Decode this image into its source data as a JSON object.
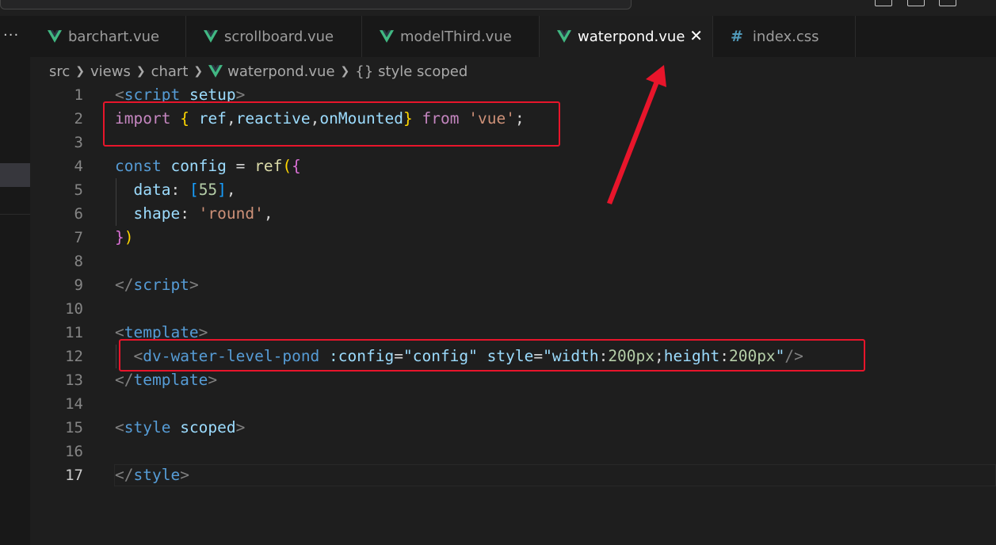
{
  "tabs": [
    {
      "label": "barchart.vue",
      "type": "vue",
      "active": false
    },
    {
      "label": "scrollboard.vue",
      "type": "vue",
      "active": false
    },
    {
      "label": "modelThird.vue",
      "type": "vue",
      "active": false
    },
    {
      "label": "waterpond.vue",
      "type": "vue",
      "active": true,
      "close": "✕"
    },
    {
      "label": "index.css",
      "type": "css",
      "active": false,
      "icon": "#"
    }
  ],
  "activity": {
    "more": "···"
  },
  "breadcrumb": {
    "items": [
      "src",
      "views",
      "chart",
      "waterpond.vue",
      "style scoped"
    ],
    "brace": "{}"
  },
  "editor": {
    "current_line": 17,
    "line_numbers": [
      "1",
      "2",
      "3",
      "4",
      "5",
      "6",
      "7",
      "8",
      "9",
      "10",
      "11",
      "12",
      "13",
      "14",
      "15",
      "16",
      "17"
    ],
    "line1": {
      "t1": "<",
      "t2": "script",
      "t3": " ",
      "t4": "setup",
      "t5": ">"
    },
    "line2": {
      "t1": "import",
      "t2": " ",
      "t3": "{",
      "t4": " ",
      "t5": "ref",
      "t6": ",",
      "t7": "reactive",
      "t8": ",",
      "t9": "onMounted",
      "t10": "}",
      "t11": " ",
      "t12": "from",
      "t13": " ",
      "t14": "'vue'",
      "t15": ";"
    },
    "line4": {
      "t1": "const",
      "t2": " ",
      "t3": "config",
      "t4": " = ",
      "t5": "ref",
      "t6": "(",
      "t7": "{"
    },
    "line5": {
      "t1": "  ",
      "t2": "data",
      "t3": ": ",
      "t4": "[",
      "t5": "55",
      "t6": "]",
      "t7": ","
    },
    "line6": {
      "t1": "  ",
      "t2": "shape",
      "t3": ": ",
      "t4": "'round'",
      "t5": ","
    },
    "line7": {
      "t1": "}",
      "t2": ")"
    },
    "line9": {
      "t1": "</",
      "t2": "script",
      "t3": ">"
    },
    "line11": {
      "t1": "<",
      "t2": "template",
      "t3": ">"
    },
    "line12": {
      "t1": "  ",
      "t2": "<",
      "t3": "dv-water-level-pond",
      "t4": " ",
      "t5": ":config",
      "t6": "=",
      "t7": "\"config\"",
      "t8": " ",
      "t9": "style",
      "t10": "=",
      "t11": "\"",
      "t12": "width",
      "t13": ":",
      "t14": "200px",
      "t15": ";",
      "t16": "height",
      "t17": ":",
      "t18": "200px",
      "t19": "\"",
      "t20": "/>"
    },
    "line13": {
      "t1": "</",
      "t2": "template",
      "t3": ">"
    },
    "line15": {
      "t1": "<",
      "t2": "style",
      "t3": " ",
      "t4": "scoped",
      "t5": ">"
    },
    "line17": {
      "t1": "</",
      "t2": "style",
      "t3": ">"
    }
  },
  "colors": {
    "annotation_red": "#e8152b",
    "vue_green": "#41b883",
    "css_blue": "#519aba"
  },
  "icons": [
    "vue-file-icon",
    "css-file-icon",
    "close-icon",
    "chevron-right-icon",
    "more-icon"
  ]
}
